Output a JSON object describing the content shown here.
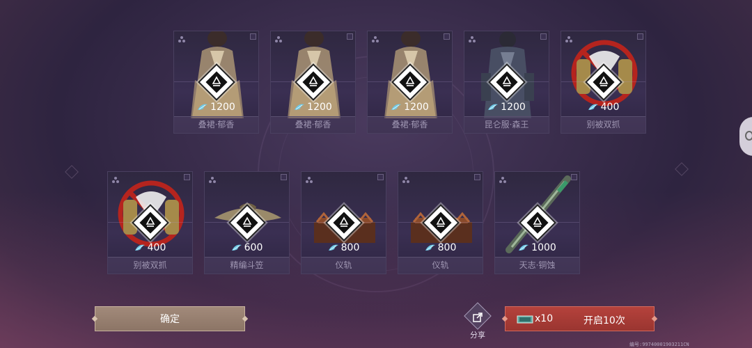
{
  "items": [
    {
      "name": "叠裙·郁香",
      "price": "1200",
      "art": "robe-gold"
    },
    {
      "name": "叠裙·郁香",
      "price": "1200",
      "art": "robe-gold"
    },
    {
      "name": "叠裙·郁香",
      "price": "1200",
      "art": "robe-gold"
    },
    {
      "name": "昆仑服·森王",
      "price": "1200",
      "art": "robe-dark"
    },
    {
      "name": "别被双抓",
      "price": "400",
      "art": "banned-claws"
    },
    {
      "name": "别被双抓",
      "price": "400",
      "art": "banned-claws"
    },
    {
      "name": "精编斗笠",
      "price": "600",
      "art": "straw-hat"
    },
    {
      "name": "仪轨",
      "price": "800",
      "art": "ritual-shrine"
    },
    {
      "name": "仪轨",
      "price": "800",
      "art": "ritual-shrine"
    },
    {
      "name": "天志·铜蚀",
      "price": "1000",
      "art": "bronze-sword"
    }
  ],
  "buttons": {
    "confirm": "确定",
    "share": "分享",
    "open_count": "x10",
    "open_label": "开启10次"
  },
  "footer": {
    "serial": "编号:99740001903211CN"
  },
  "icons": {
    "currency": "jade-feather-icon",
    "recycle": "recycle-diamond-icon",
    "share": "share-icon",
    "ticket": "ticket-icon"
  },
  "colors": {
    "confirm_bg": "#9a8272",
    "open_bg": "#a83b35",
    "card_bg": "#332a48",
    "currency": "#6fc9e6"
  }
}
